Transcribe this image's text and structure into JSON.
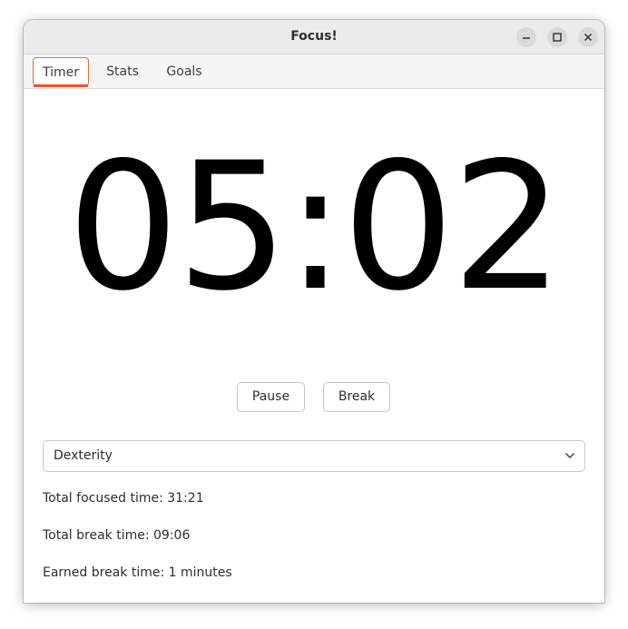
{
  "window": {
    "title": "Focus!",
    "controls": {
      "minimize": "minimize-icon",
      "maximize": "maximize-icon",
      "close": "close-icon"
    }
  },
  "tabs": [
    {
      "label": "Timer",
      "active": true
    },
    {
      "label": "Stats",
      "active": false
    },
    {
      "label": "Goals",
      "active": false
    }
  ],
  "timer": {
    "display": "05:02",
    "pause_label": "Pause",
    "break_label": "Break"
  },
  "activity_select": {
    "selected": "Dexterity",
    "icon": "chevron-down-icon"
  },
  "stats": {
    "total_focused": "Total focused time: 31:21",
    "total_break": "Total break time: 09:06",
    "earned_break": "Earned break time: 1 minutes"
  },
  "colors": {
    "accent": "#e9542a",
    "titlebar": "#ebebeb",
    "tabbar": "#f5f5f5"
  }
}
